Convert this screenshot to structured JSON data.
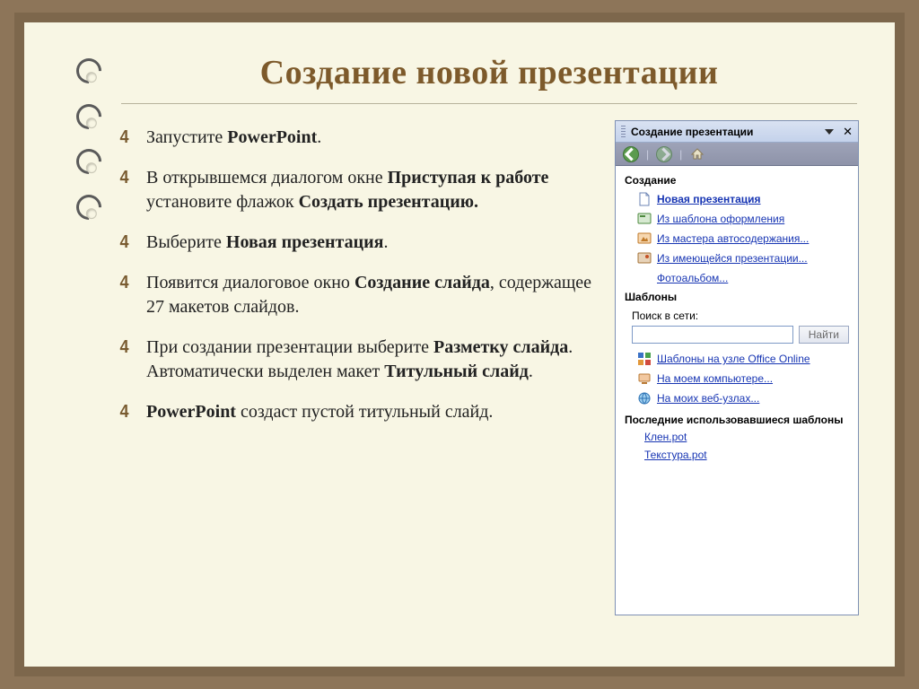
{
  "slide": {
    "title": "Создание новой презентации"
  },
  "bullets": [
    {
      "pre": "Запустите ",
      "b": "PowerPoint",
      "post": "."
    },
    {
      "pre": "В открывшемся диалогом окне ",
      "b": "Приступая к работе",
      "mid": " установите флажок ",
      "b2": "Создать презентацию.",
      "post": ""
    },
    {
      "pre": "Выберите ",
      "b": "Новая презентация",
      "post": "."
    },
    {
      "pre": "Появится диалоговое окно ",
      "b": "Создание слайда",
      "post": ", содержащее 27 макетов слайдов."
    },
    {
      "pre": "При создании презентации выберите ",
      "b": "Разметку слайда",
      "mid": ". Автоматически выделен макет ",
      "b2": "Титульный слайд",
      "post": "."
    },
    {
      "pre": "",
      "b": "PowerPoint",
      "post": " создаст пустой титульный слайд."
    }
  ],
  "pane": {
    "title": "Создание презентации",
    "sections": {
      "create": "Создание",
      "templates": "Шаблоны",
      "search_label": "Поиск в сети:",
      "search_btn": "Найти",
      "recent": "Последние использовавшиеся шаблоны"
    },
    "create_links": {
      "new_presentation": "Новая презентация",
      "from_design": "Из шаблона оформления",
      "from_wizard": "Из мастера автосодержания...",
      "from_existing": "Из имеющейся презентации...",
      "photoalbum": "Фотоальбом..."
    },
    "template_links": {
      "office_online": "Шаблоны на узле Office Online",
      "on_computer": "На моем компьютере...",
      "on_websites": "На моих веб-узлах..."
    },
    "recent_links": {
      "r1": "Клен.pot",
      "r2": "Текстура.pot"
    }
  }
}
